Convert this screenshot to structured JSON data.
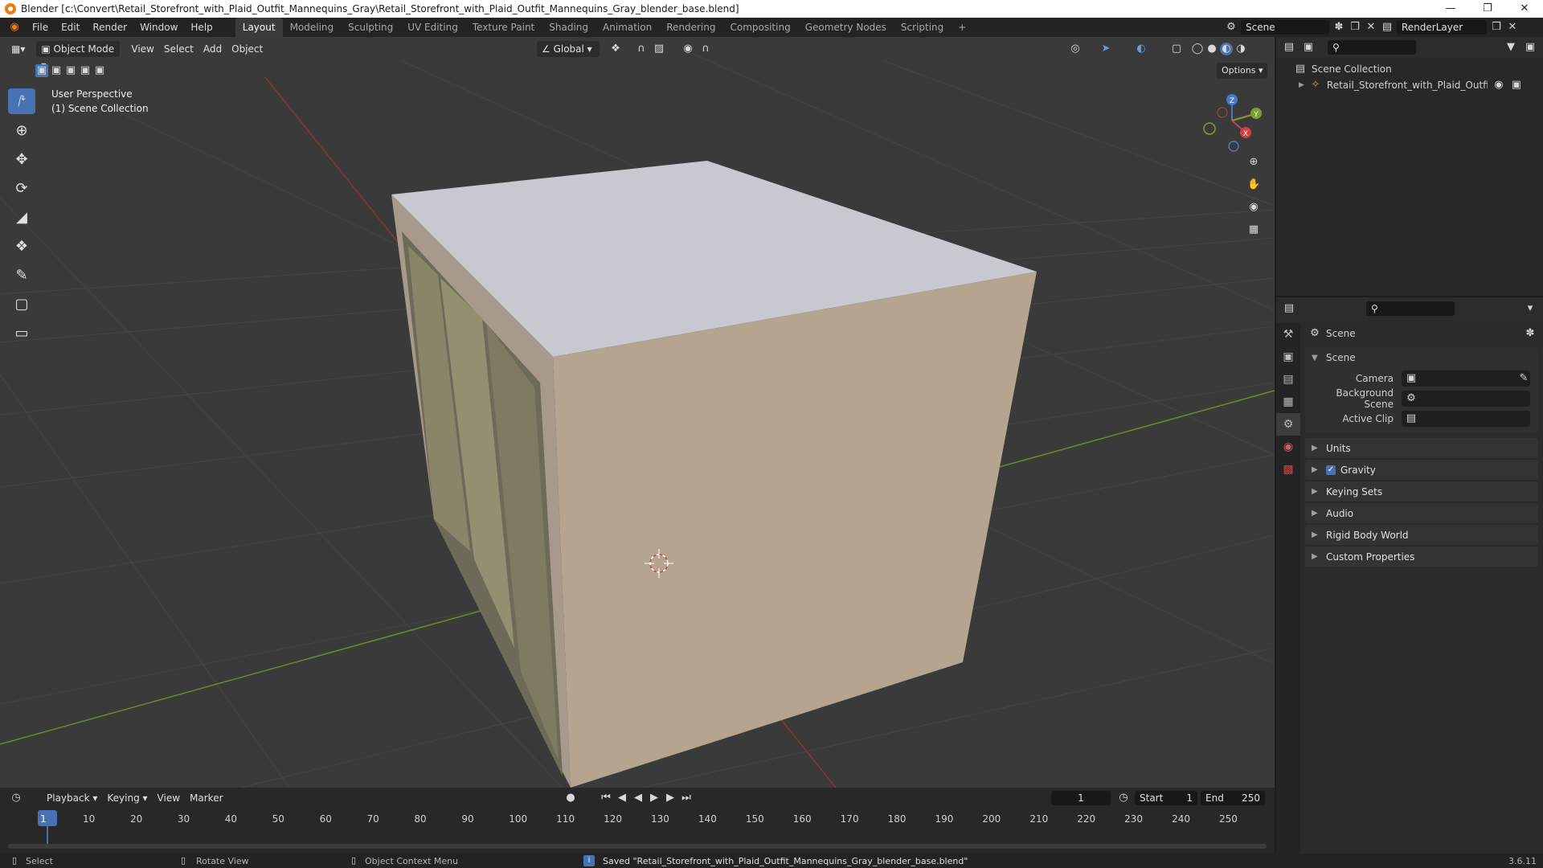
{
  "window": {
    "title": "Blender [c:\\Convert\\Retail_Storefront_with_Plaid_Outfit_Mannequins_Gray\\Retail_Storefront_with_Plaid_Outfit_Mannequins_Gray_blender_base.blend]"
  },
  "menu": [
    "File",
    "Edit",
    "Render",
    "Window",
    "Help"
  ],
  "workspaces": [
    "Layout",
    "Modeling",
    "Sculpting",
    "UV Editing",
    "Texture Paint",
    "Shading",
    "Animation",
    "Rendering",
    "Compositing",
    "Geometry Nodes",
    "Scripting"
  ],
  "active_workspace": "Layout",
  "scene_name": "Scene",
  "render_layer": "RenderLayer",
  "viewport": {
    "mode": "Object Mode",
    "menus": [
      "View",
      "Select",
      "Add",
      "Object"
    ],
    "transform_orientation": "Global",
    "options_label": "Options",
    "overlay_line1": "User Perspective",
    "overlay_line2": "(1) Scene Collection"
  },
  "gizmo": {
    "x": "X",
    "y": "Y",
    "z": "Z"
  },
  "outliner": {
    "root": "Scene Collection",
    "items": [
      {
        "label": "Retail_Storefront_with_Plaid_Outfit_Mar"
      }
    ]
  },
  "properties": {
    "header": "Scene",
    "section": "Scene",
    "fields": [
      {
        "label": "Camera"
      },
      {
        "label": "Background Scene"
      },
      {
        "label": "Active Clip"
      }
    ],
    "panels": [
      {
        "label": "Units",
        "checkbox": false
      },
      {
        "label": "Gravity",
        "checkbox": true
      },
      {
        "label": "Keying Sets",
        "checkbox": false
      },
      {
        "label": "Audio",
        "checkbox": false
      },
      {
        "label": "Rigid Body World",
        "checkbox": false
      },
      {
        "label": "Custom Properties",
        "checkbox": false
      }
    ]
  },
  "timeline": {
    "menus": [
      "Playback",
      "Keying",
      "View",
      "Marker"
    ],
    "current_frame": "1",
    "start_label": "Start",
    "start": "1",
    "end_label": "End",
    "end": "250",
    "ticks": [
      "1",
      "10",
      "20",
      "30",
      "40",
      "50",
      "60",
      "70",
      "80",
      "90",
      "100",
      "110",
      "120",
      "130",
      "140",
      "150",
      "160",
      "170",
      "180",
      "190",
      "200",
      "210",
      "220",
      "230",
      "240",
      "250"
    ]
  },
  "statusbar": {
    "select": "Select",
    "rotate": "Rotate View",
    "context": "Object Context Menu",
    "message": "Saved \"Retail_Storefront_with_Plaid_Outfit_Mannequins_Gray_blender_base.blend\"",
    "version": "3.6.11"
  },
  "colors": {
    "accent": "#4772b3",
    "box_top": "#c8c8d0",
    "box_front": "#b4a490",
    "box_left": "#a09484",
    "x_axis": "#c84040",
    "y_axis": "#7aa030"
  }
}
